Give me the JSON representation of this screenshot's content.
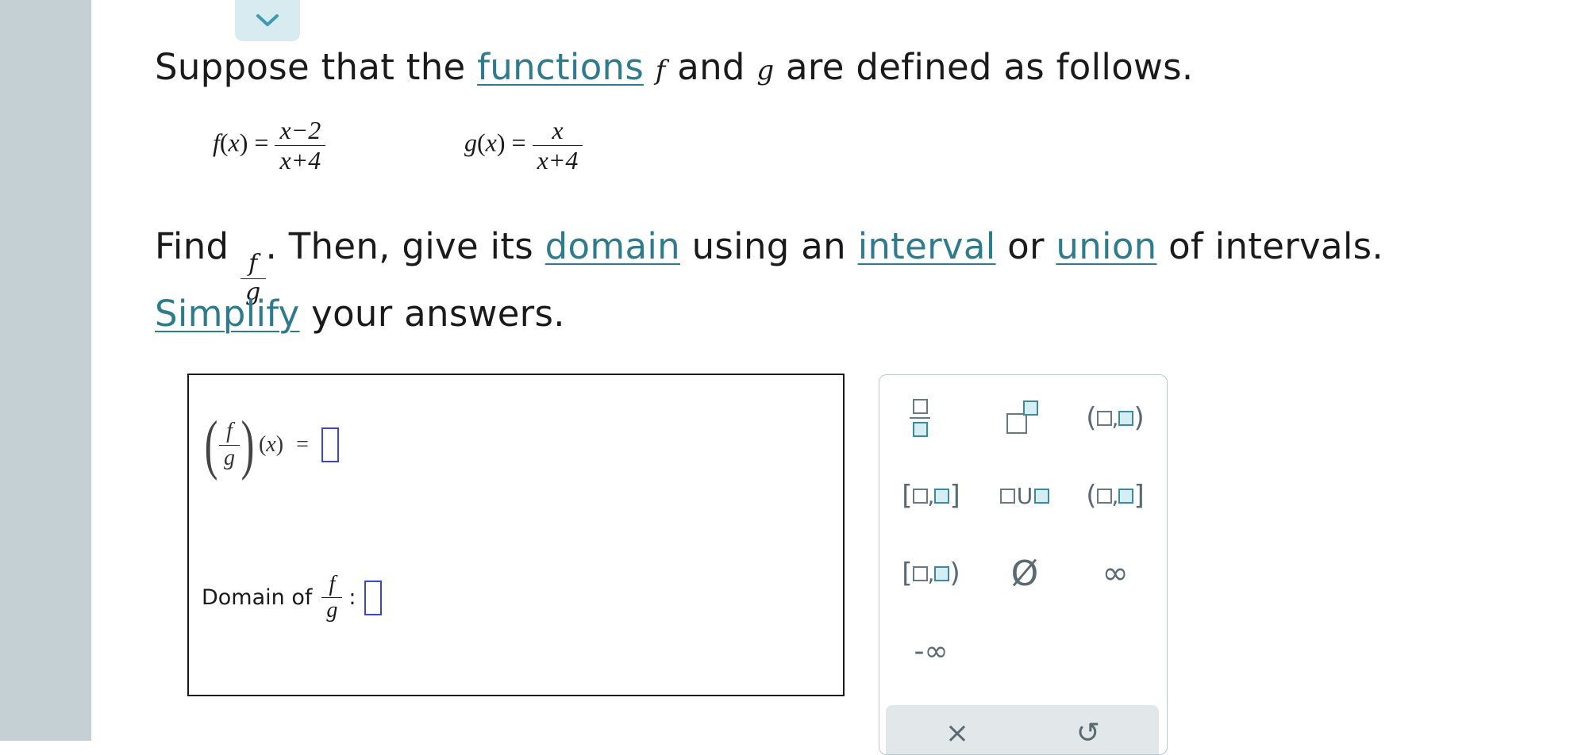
{
  "prompt": {
    "line1": {
      "intro": "Suppose that the ",
      "functions_link": "functions",
      "f": "f",
      "and": " and ",
      "g": "g",
      "rest": " are defined as follows."
    },
    "f_def": {
      "lhs": "f",
      "x": "x",
      "num": "x−2",
      "den": "x+4"
    },
    "g_def": {
      "lhs": "g",
      "x": "x",
      "num": "x",
      "den": "x+4"
    },
    "line2": {
      "find": "Find ",
      "frac_num": "f",
      "frac_den": "g",
      "after_frac": ". Then, give its ",
      "domain_link": "domain",
      "using": " using an ",
      "interval_link": "interval",
      "or": " or ",
      "union_link": "union",
      "end": " of intervals."
    },
    "line3": {
      "simplify_link": "Simplify",
      "rest": " your answers."
    }
  },
  "answer": {
    "quotient_label": {
      "num": "f",
      "den": "g",
      "x": "x",
      "eq": "="
    },
    "domain_label": {
      "text": "Domain of",
      "num": "f",
      "den": "g",
      "colon": ":"
    }
  },
  "keypad": {
    "keys": [
      "fraction-key",
      "exponent-key",
      "open-open-interval-key",
      "closed-closed-interval-key",
      "union-key",
      "open-closed-interval-key",
      "closed-open-interval-key",
      "empty-set-key",
      "infinity-key",
      "negative-infinity-key"
    ],
    "symbols": {
      "empty_set": "Ø",
      "infinity": "∞",
      "neg_infinity": "-∞",
      "union": "U"
    },
    "footer": {
      "clear": "×",
      "undo": "↺"
    }
  },
  "colors": {
    "link": "#2d7b8c",
    "sidebar": "#c5d0d4",
    "placeholder": "#3a45d6",
    "keypad_teal": "#3d8a9c"
  }
}
